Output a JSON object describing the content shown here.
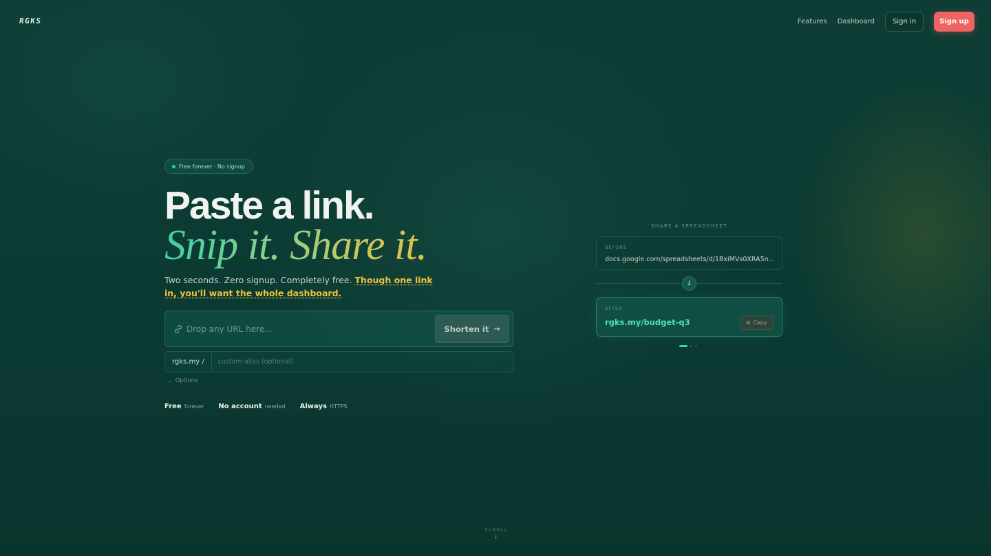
{
  "app": {
    "logo": "RGKS"
  },
  "nav": {
    "features": "Features",
    "dashboard": "Dashboard",
    "sign_in": "Sign in",
    "sign_up": "Sign up"
  },
  "hero": {
    "badge": "Free forever · No signup",
    "headline": "Paste a link.",
    "tagline": "Snip it. Share it.",
    "sub_plain": "Two seconds. Zero signup. Completely free. ",
    "sub_highlight": "Though one link in, you'll want the whole dashboard."
  },
  "shortener": {
    "url_placeholder": "Drop any URL here...",
    "url_value": "",
    "submit_label": "Shorten it",
    "alias_prefix": "rgks.my /",
    "alias_placeholder": "custom-alias (optional)",
    "alias_value": "",
    "options_label": "Options"
  },
  "features": [
    {
      "strong": "Free",
      "muted": "forever"
    },
    {
      "strong": "No account",
      "muted": "needed"
    },
    {
      "strong": "Always",
      "muted": "HTTPS"
    }
  ],
  "demo": {
    "title": "SHARE A SPREADSHEET",
    "before_label": "BEFORE",
    "before_value": "docs.google.com/spreadsheets/d/1BxiMVs0XRA5n...",
    "after_label": "AFTER",
    "after_value": "rgks.my/budget-q3",
    "copy_label": "Copy",
    "active_slide": 1,
    "slide_count": 3
  },
  "scroll_label": "SCROLL",
  "colors": {
    "background": "#0c3a32",
    "accent_green": "#3fd2b0",
    "accent_gold": "#f0c23b",
    "signup_red": "#ef6461"
  },
  "icons": {
    "link": "link-icon",
    "arrow_right": "arrow-right-icon",
    "arrow_down": "arrow-down-icon",
    "copy": "copy-icon",
    "chevron": "chevron-down-icon"
  }
}
